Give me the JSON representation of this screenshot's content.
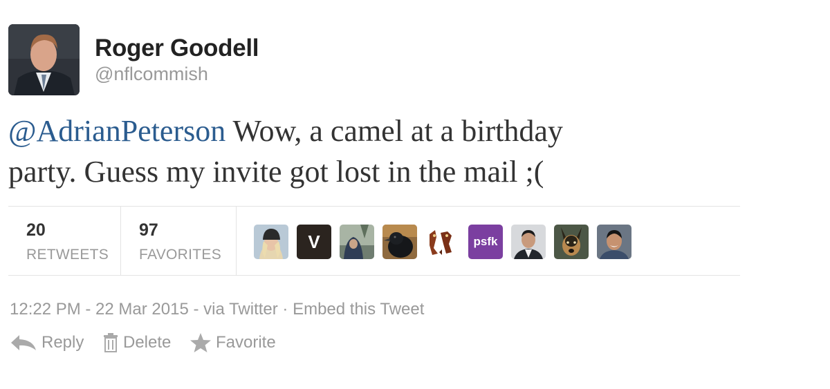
{
  "author": {
    "name": "Roger Goodell",
    "handle": "@nflcommish"
  },
  "tweet": {
    "mention": "@AdrianPeterson",
    "text_line1": " Wow, a camel at a birthday",
    "text_line2": "party. Guess my invite got lost in the mail ;("
  },
  "stats": {
    "retweets_count": "20",
    "retweets_label": "RETWEETS",
    "favorites_count": "97",
    "favorites_label": "FAVORITES"
  },
  "favoriters": [
    {
      "icon": "avatar-blonde-beanie"
    },
    {
      "icon": "avatar-v-logo",
      "text": "V"
    },
    {
      "icon": "avatar-hooded-outdoors"
    },
    {
      "icon": "avatar-crow"
    },
    {
      "icon": "avatar-bear-illustration"
    },
    {
      "icon": "avatar-psfk-logo",
      "text": "psfk"
    },
    {
      "icon": "avatar-man-suit"
    },
    {
      "icon": "avatar-dog"
    },
    {
      "icon": "avatar-smiling-man"
    }
  ],
  "meta": {
    "timestamp": "12:22 PM - 22 Mar 2015",
    "separator1": " - via ",
    "source": "Twitter",
    "separator2": " · ",
    "embed": "Embed this Tweet"
  },
  "actions": {
    "reply": "Reply",
    "delete": "Delete",
    "favorite": "Favorite"
  },
  "colors": {
    "mention": "#2b5c8f",
    "muted": "#999999",
    "psfk": "#7b3fa0"
  }
}
